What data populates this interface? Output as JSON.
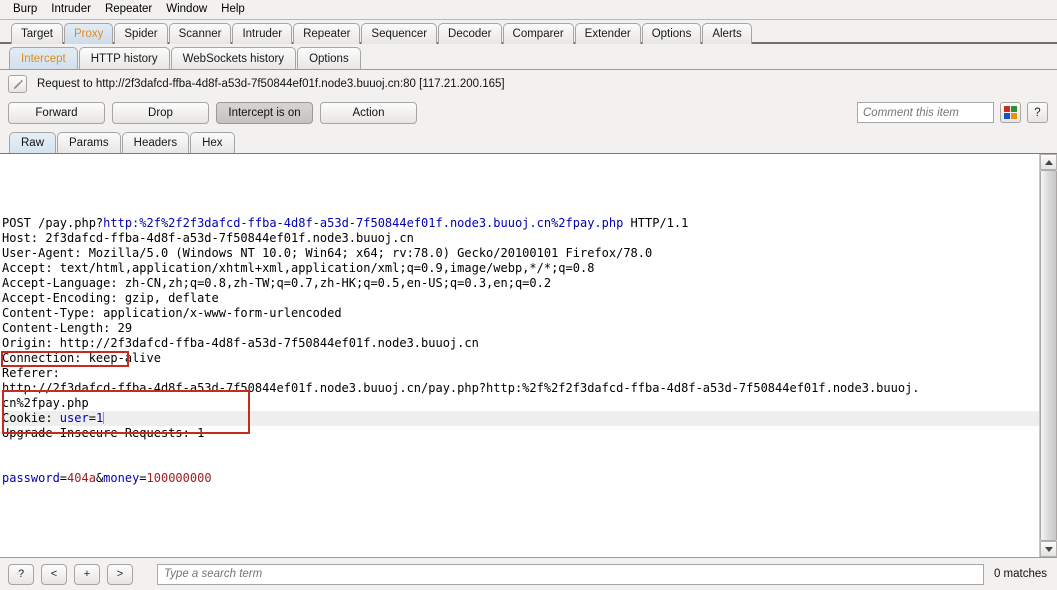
{
  "menu": {
    "items": [
      "Burp",
      "Intruder",
      "Repeater",
      "Window",
      "Help"
    ]
  },
  "main_tabs": {
    "active": "Proxy",
    "items": [
      "Target",
      "Proxy",
      "Spider",
      "Scanner",
      "Intruder",
      "Repeater",
      "Sequencer",
      "Decoder",
      "Comparer",
      "Extender",
      "Options",
      "Alerts"
    ]
  },
  "sub_tabs": {
    "active": "Intercept",
    "items": [
      "Intercept",
      "HTTP history",
      "WebSockets history",
      "Options"
    ]
  },
  "info": {
    "text": "Request to http://2f3dafcd-ffba-4d8f-a53d-7f50844ef01f.node3.buuoj.cn:80  [117.21.200.165]",
    "pencil_icon": "pencil-icon"
  },
  "toolbar": {
    "forward_label": "Forward",
    "drop_label": "Drop",
    "intercept_label": "Intercept is on",
    "action_label": "Action",
    "comment_placeholder": "Comment this item",
    "comment_value": "",
    "highlight_icon": "color-swatch-icon",
    "help_label": "?",
    "swatch_colors": [
      "#cc2b1d",
      "#2f8f2f",
      "#2050c8",
      "#e8930f"
    ]
  },
  "editor_tabs": {
    "active": "Raw",
    "items": [
      "Raw",
      "Params",
      "Headers",
      "Hex"
    ]
  },
  "request": {
    "lines": [
      {
        "highlight": false,
        "boxed": false,
        "spans": [
          {
            "t": "POST /pay.php?",
            "c": "black"
          },
          {
            "t": "http:%2f%2f2f3dafcd-ffba-4d8f-a53d-7f50844ef01f.node3.buuoj.cn%2fpay.php",
            "c": "blue"
          },
          {
            "t": " HTTP/1.1",
            "c": "black"
          }
        ]
      },
      {
        "highlight": false,
        "boxed": false,
        "spans": [
          {
            "t": "Host: 2f3dafcd-ffba-4d8f-a53d-7f50844ef01f.node3.buuoj.cn",
            "c": "black"
          }
        ]
      },
      {
        "highlight": false,
        "boxed": false,
        "spans": [
          {
            "t": "User-Agent: Mozilla/5.0 (Windows NT 10.0; Win64; x64; rv:78.0) Gecko/20100101 Firefox/78.0",
            "c": "black"
          }
        ]
      },
      {
        "highlight": false,
        "boxed": false,
        "spans": [
          {
            "t": "Accept: text/html,application/xhtml+xml,application/xml;q=0.9,image/webp,*/*;q=0.8",
            "c": "black"
          }
        ]
      },
      {
        "highlight": false,
        "boxed": false,
        "spans": [
          {
            "t": "Accept-Language: zh-CN,zh;q=0.8,zh-TW;q=0.7,zh-HK;q=0.5,en-US;q=0.3,en;q=0.2",
            "c": "black"
          }
        ]
      },
      {
        "highlight": false,
        "boxed": false,
        "spans": [
          {
            "t": "Accept-Encoding: gzip, deflate",
            "c": "black"
          }
        ]
      },
      {
        "highlight": false,
        "boxed": false,
        "spans": [
          {
            "t": "Content-Type: application/x-www-form-urlencoded",
            "c": "black"
          }
        ]
      },
      {
        "highlight": false,
        "boxed": false,
        "spans": [
          {
            "t": "Content-Length: 29",
            "c": "black"
          }
        ]
      },
      {
        "highlight": false,
        "boxed": false,
        "spans": [
          {
            "t": "Origin: http://2f3dafcd-ffba-4d8f-a53d-7f50844ef01f.node3.buuoj.cn",
            "c": "black"
          }
        ]
      },
      {
        "highlight": false,
        "boxed": false,
        "spans": [
          {
            "t": "Connection: keep-alive",
            "c": "black"
          }
        ]
      },
      {
        "highlight": false,
        "boxed": false,
        "spans": [
          {
            "t": "Referer:",
            "c": "black"
          }
        ]
      },
      {
        "highlight": false,
        "boxed": false,
        "spans": [
          {
            "t": "http://2f3dafcd-ffba-4d8f-a53d-7f50844ef01f.node3.buuoj.cn/pay.php?http:%2f%2f2f3dafcd-ffba-4d8f-a53d-7f50844ef01f.node3.buuoj.",
            "c": "black"
          }
        ]
      },
      {
        "highlight": false,
        "boxed": false,
        "spans": [
          {
            "t": "cn%2fpay.php",
            "c": "black"
          }
        ]
      },
      {
        "highlight": true,
        "boxed": true,
        "caret": true,
        "spans": [
          {
            "t": "Cookie: ",
            "c": "black"
          },
          {
            "t": "user",
            "c": "blue"
          },
          {
            "t": "=",
            "c": "black"
          },
          {
            "t": "1",
            "c": "blue"
          }
        ]
      },
      {
        "highlight": false,
        "boxed": false,
        "spans": [
          {
            "t": "Upgrade-Insecure-Requests: 1",
            "c": "black"
          }
        ]
      },
      {
        "highlight": false,
        "boxed": false,
        "spans": [
          {
            "t": "",
            "c": "black"
          }
        ]
      },
      {
        "highlight": false,
        "boxed": false,
        "spans": [
          {
            "t": "",
            "c": "black"
          }
        ]
      },
      {
        "highlight": false,
        "boxed": true,
        "spans": [
          {
            "t": "password",
            "c": "blue"
          },
          {
            "t": "=",
            "c": "black"
          },
          {
            "t": "404a",
            "c": "dkred"
          },
          {
            "t": "&",
            "c": "black"
          },
          {
            "t": "money",
            "c": "blue"
          },
          {
            "t": "=",
            "c": "black"
          },
          {
            "t": "100000000",
            "c": "dkred"
          }
        ]
      }
    ]
  },
  "search": {
    "help_label": "?",
    "prev_label": "<",
    "add_label": "+",
    "next_label": ">",
    "placeholder": "Type a search term",
    "value": "",
    "matches": "0 matches"
  },
  "colors": {
    "accent_orange": "#e08c1a",
    "box_red": "#c42b21",
    "token_blue": "#0000b4",
    "token_darkred": "#9c2020",
    "caret": "#e8891c"
  }
}
